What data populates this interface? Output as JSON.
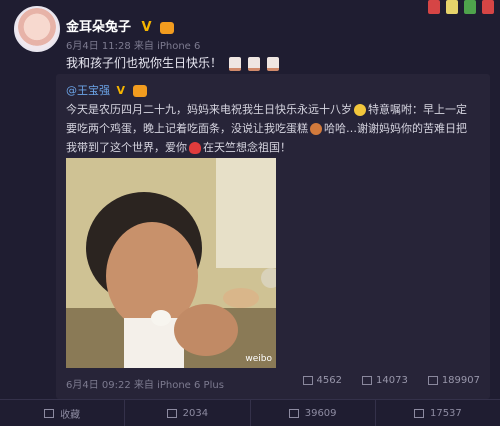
{
  "user": {
    "name": "金耳朵兔子",
    "vip_mark": "V",
    "meta": "6月4日 11:28 来自 iPhone 6",
    "text": "我和孩子们也祝你生日快乐！"
  },
  "repost": {
    "user": "@王宝强",
    "vip_mark": "V",
    "text_1": "今天是农历四月二十九，妈妈来电祝我生日快乐永远十八岁",
    "text_2": "特意嘱咐：早上一定要吃两个鸡蛋，晚上记着吃面条，没说让我吃蛋糕",
    "text_3": "哈哈…谢谢妈妈你的苦难日把我带到了这个世界，爱你",
    "text_4": "在天竺想念祖国！",
    "image_watermark": "weibo",
    "meta": "6月4日 09:22 来自 iPhone 6 Plus",
    "stats": {
      "reposts": "4562",
      "comments": "14073",
      "likes": "189907"
    }
  },
  "actions": {
    "favorite": "收藏",
    "forward": "2034",
    "comment": "39609",
    "like": "17537"
  },
  "colors": {
    "background": "#1f1d31",
    "repost_bg": "#272438",
    "link": "#6ba3e6",
    "vip": "#f5b400"
  }
}
